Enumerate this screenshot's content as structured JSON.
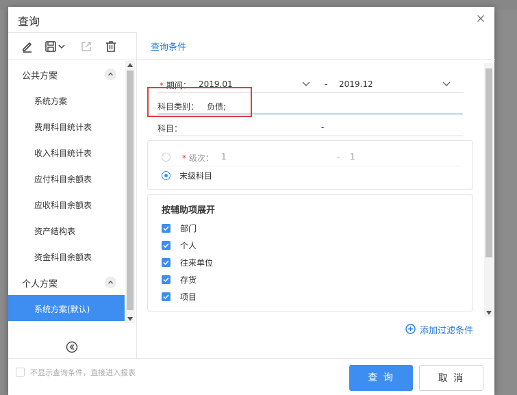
{
  "dialog": {
    "title": "查询"
  },
  "left": {
    "public_group": "公共方案",
    "public_items": [
      "系统方案",
      "费用科目统计表",
      "收入科目统计表",
      "应付科目余额表",
      "应收科目余额表",
      "资产结构表",
      "资金科目余额表"
    ],
    "personal_group": "个人方案",
    "personal_items": [
      "系统方案(默认)"
    ]
  },
  "right": {
    "tab": "查询条件",
    "period": {
      "label": "期间：",
      "from": "2019.01",
      "sep": "-",
      "to": "2019.12"
    },
    "subject_type": {
      "label": "科目类别：",
      "value": "负债;"
    },
    "subject": {
      "label": "科目：",
      "sep": "-"
    },
    "level": {
      "label": "级次：",
      "from": "1",
      "sep": "-",
      "to": "1",
      "leaf_label": "末级科目"
    },
    "aux": {
      "title": "按辅助项展开",
      "items": [
        "部门",
        "个人",
        "往来单位",
        "存货",
        "项目"
      ]
    },
    "add_filter": "添加过滤条件"
  },
  "footer": {
    "skip_text": "不显示查询条件，直接进入报表",
    "query_button": "查 询",
    "cancel_button": "取 消"
  },
  "colors": {
    "accent": "#3d8ef0",
    "link": "#1f7ad8",
    "highlight_box": "#e23c3c",
    "required": "#e02f2f"
  },
  "icons": [
    "edit-icon",
    "save-icon",
    "chevron-down-icon",
    "export-icon",
    "trash-icon",
    "chevron-up-icon",
    "collapse-left-icon",
    "close-icon",
    "add-circle-icon",
    "check-icon"
  ]
}
